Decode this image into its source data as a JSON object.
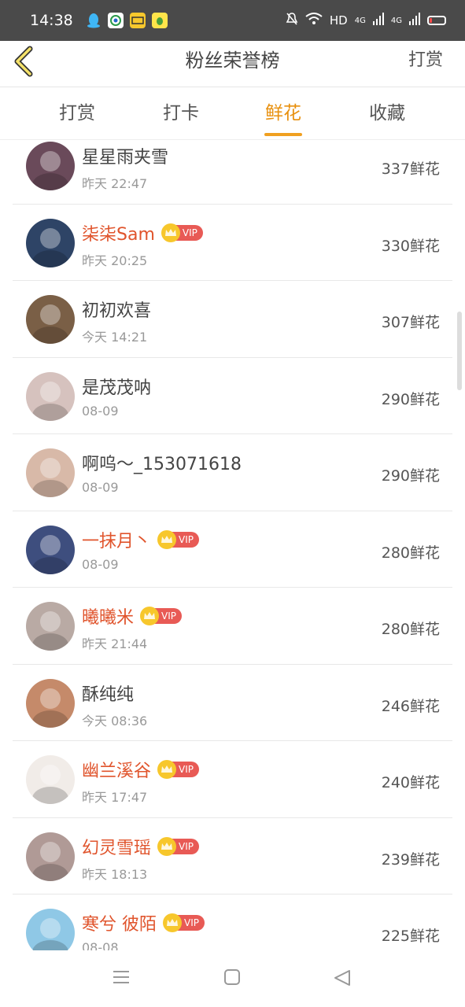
{
  "status_bar": {
    "time": "14:38",
    "network": "HD",
    "signal1": "4G",
    "signal2": "4G",
    "app_icons": [
      "qq-icon",
      "browser-icon",
      "yuedu-icon",
      "leaf-app-icon"
    ]
  },
  "nav": {
    "title": "粉丝荣誉榜",
    "action": "打赏"
  },
  "tabs": [
    {
      "label": "打赏"
    },
    {
      "label": "打卡"
    },
    {
      "label": "鲜花",
      "active": true
    },
    {
      "label": "收藏"
    }
  ],
  "colors": {
    "accent": "#e8900e",
    "vip_name": "#e0542c",
    "vip_badge": "#e85a55",
    "crown": "#f7c72c"
  },
  "fans": [
    {
      "name": "星星雨夹雪",
      "time": "昨天 22:47",
      "count": "337鲜花",
      "vip": false,
      "avatar_color": "#6a4a5a"
    },
    {
      "name": "柒柒Sam",
      "time": "昨天 20:25",
      "count": "330鲜花",
      "vip": true,
      "vip_label": "VIP",
      "avatar_color": "#2e4466"
    },
    {
      "name": "初初欢喜",
      "time": "今天 14:21",
      "count": "307鲜花",
      "vip": false,
      "avatar_color": "#7a5f46"
    },
    {
      "name": "是茂茂呐",
      "time": "08-09",
      "count": "290鲜花",
      "vip": false,
      "avatar_color": "#d6c2be"
    },
    {
      "name": "啊呜～_153071618",
      "time": "08-09",
      "count": "290鲜花",
      "vip": false,
      "avatar_color": "#d8b9a8"
    },
    {
      "name": "一抹月丶",
      "time": "08-09",
      "count": "280鲜花",
      "vip": true,
      "vip_label": "VIP",
      "avatar_color": "#3e4e7e"
    },
    {
      "name": "曦曦米",
      "time": "昨天 21:44",
      "count": "280鲜花",
      "vip": true,
      "vip_label": "VIP",
      "avatar_color": "#b9aaa4"
    },
    {
      "name": "酥纯纯",
      "time": "今天 08:36",
      "count": "246鲜花",
      "vip": false,
      "avatar_color": "#c58a6a"
    },
    {
      "name": "幽兰溪谷",
      "time": "昨天 17:47",
      "count": "240鲜花",
      "vip": true,
      "vip_label": "VIP",
      "avatar_color": "#f1ece8"
    },
    {
      "name": "幻灵雪瑶",
      "time": "昨天 18:13",
      "count": "239鲜花",
      "vip": true,
      "vip_label": "VIP",
      "avatar_color": "#b09a96"
    },
    {
      "name": "寒兮 彼陌",
      "time": "08-08",
      "count": "225鲜花",
      "vip": true,
      "vip_label": "VIP",
      "avatar_color": "#8fc8e6"
    }
  ]
}
